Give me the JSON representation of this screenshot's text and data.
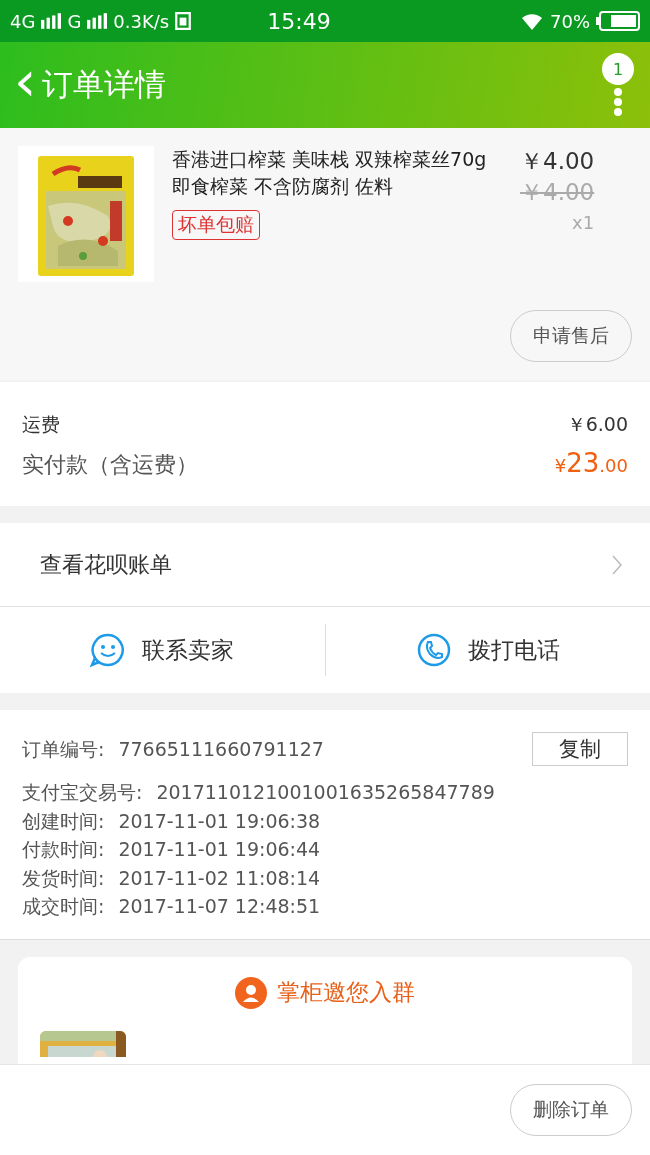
{
  "status_bar": {
    "network": "4G",
    "network2": "G",
    "speed": "0.3K/s",
    "time": "15:49",
    "battery": "70%"
  },
  "header": {
    "back": "‹",
    "title": "订单详情",
    "badge": "1"
  },
  "product": {
    "kind": "picture",
    "title": "香港进口榨菜 美味栈 双辣榨菜丝70g 即食榨菜 不含防腐剂 佐料",
    "tag": "坏单包赔",
    "price": "￥4.00",
    "original_price": "￥4.00",
    "quantity": "x1",
    "after_sale_button": "申请售后"
  },
  "fees": [
    {
      "label": "运费",
      "value": "￥6.00"
    }
  ],
  "total": {
    "label": "实付款（含运费）",
    "currency": "¥",
    "integer": "23",
    "decimal": ".00"
  },
  "huabei": {
    "label": "查看花呗账单"
  },
  "contact": [
    {
      "kind": "chat",
      "label": "联系卖家"
    },
    {
      "kind": "phone",
      "label": "拨打电话"
    }
  ],
  "order_info": [
    {
      "label": "订单编号:",
      "value": "77665111660791127"
    },
    {
      "label": "支付宝交易号:",
      "value": "2017110121001001635265847789"
    },
    {
      "label": "创建时间:",
      "value": "2017-11-01 19:06:38"
    },
    {
      "label": "付款时间:",
      "value": "2017-11-01 19:06:44"
    },
    {
      "label": "发货时间:",
      "value": "2017-11-02 11:08:14"
    },
    {
      "label": "成交时间:",
      "value": "2017-11-07 12:48:51"
    }
  ],
  "copy_button": "复制",
  "group": {
    "title": "掌柜邀您入群"
  },
  "footer": {
    "delete_button": "删除订单"
  }
}
